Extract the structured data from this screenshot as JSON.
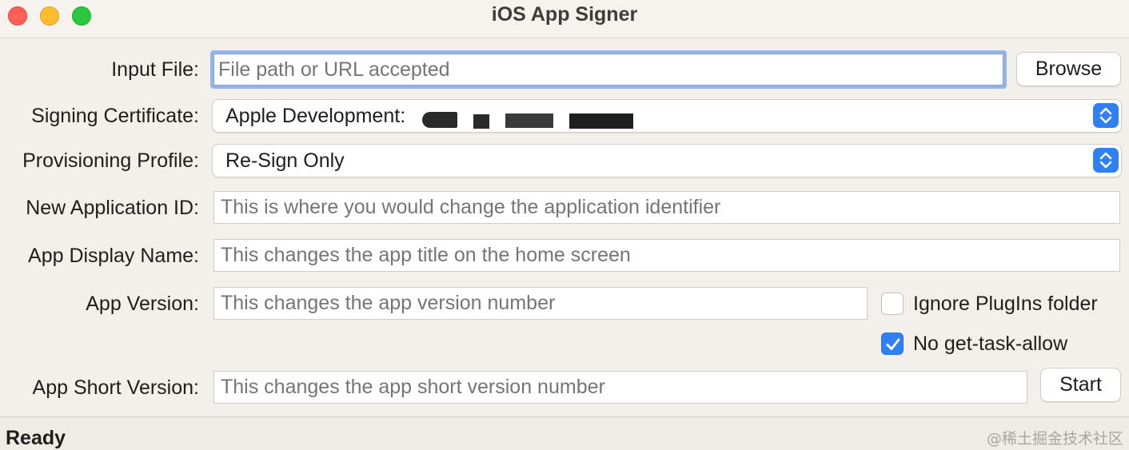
{
  "window": {
    "title": "iOS App Signer"
  },
  "form": {
    "input_file": {
      "label": "Input File:",
      "placeholder": "File path or URL accepted",
      "value": ""
    },
    "browse_button": "Browse",
    "signing_certificate": {
      "label": "Signing Certificate:",
      "selected": "Apple Development:"
    },
    "provisioning_profile": {
      "label": "Provisioning Profile:",
      "selected": "Re-Sign Only"
    },
    "new_app_id": {
      "label": "New Application ID:",
      "placeholder": "This is where you would change the application identifier"
    },
    "display_name": {
      "label": "App Display Name:",
      "placeholder": "This changes the app title on the home screen"
    },
    "app_version": {
      "label": "App Version:",
      "placeholder": "This changes the app version number"
    },
    "short_version": {
      "label": "App Short Version:",
      "placeholder": "This changes the app short version number"
    },
    "ignore_plugins": {
      "label": "Ignore PlugIns folder",
      "checked": false
    },
    "no_get_task_allow": {
      "label": "No get-task-allow",
      "checked": true
    },
    "start_button": "Start"
  },
  "status_bar": {
    "text": "Ready",
    "watermark": "@稀土掘金技术社区"
  },
  "colors": {
    "accent": "#2f7ff5",
    "focus_ring": "#93b5ea",
    "window_bg": "#f3efea"
  },
  "icons": {
    "popup_indicator": "up-down-chevron-icon",
    "checkmark": "checkmark-icon"
  }
}
